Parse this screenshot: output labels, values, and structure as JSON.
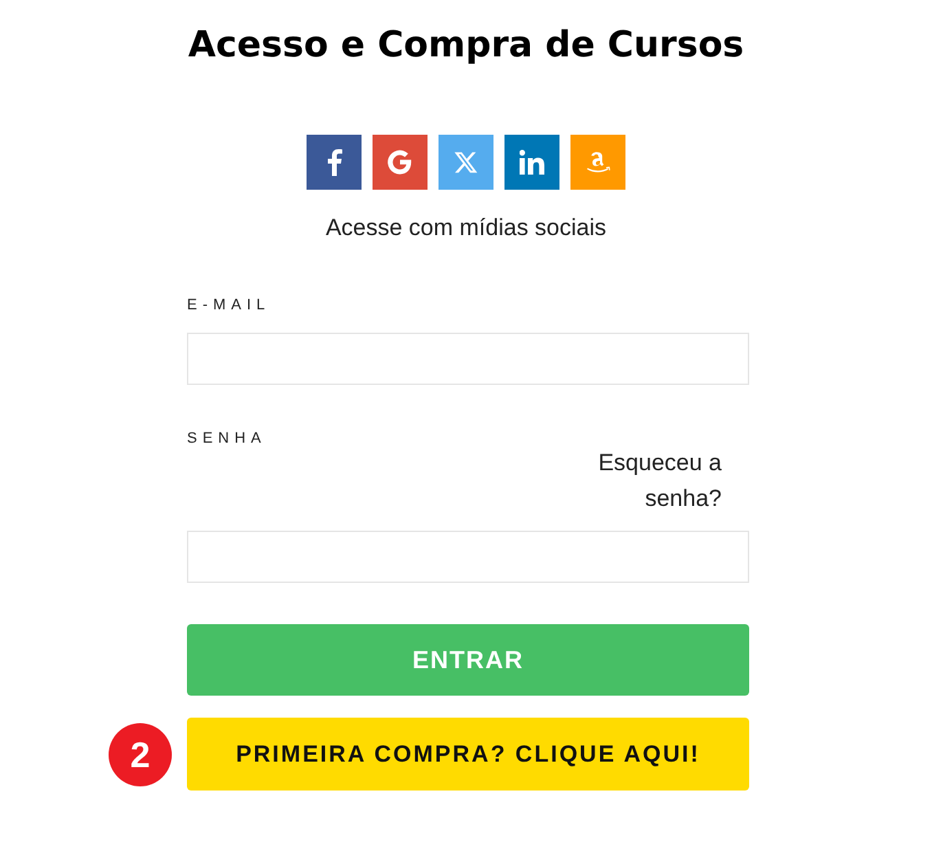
{
  "title": "Acesso e Compra de Cursos",
  "social_buttons": [
    {
      "kind": "facebook",
      "color": "#3b5998"
    },
    {
      "kind": "google",
      "color": "#dd4b39"
    },
    {
      "kind": "x",
      "color": "#55acee"
    },
    {
      "kind": "linkedin",
      "color": "#0077b5"
    },
    {
      "kind": "amazon",
      "color": "#ff9900"
    }
  ],
  "social_caption": "Acesse com mídias sociais",
  "email": {
    "label": "E-MAIL"
  },
  "password": {
    "label": "SENHA"
  },
  "forgot_link": "Esqueceu a senha?",
  "login_button": "ENTRAR",
  "first_purchase_button": "PRIMEIRA COMPRA? CLIQUE AQUI!",
  "step_badge": "2"
}
